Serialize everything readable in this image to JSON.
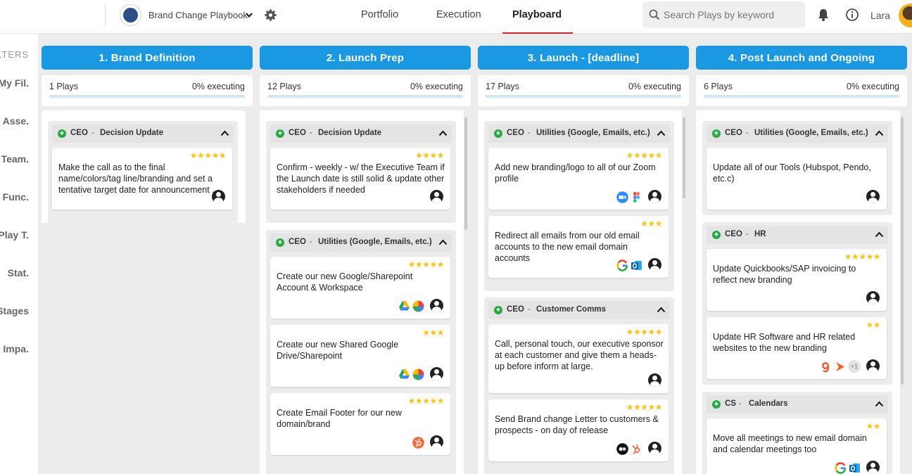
{
  "topbar": {
    "playbook_name": "Brand Change Playbook",
    "nav": [
      "Portfolio",
      "Execution",
      "Playboard"
    ],
    "active_nav": "Playboard",
    "search_placeholder": "Search Plays by keyword",
    "user_name": "Lara",
    "colors": {
      "accent_underline": "#e0202c"
    }
  },
  "filters": {
    "header": "LTERS",
    "items": [
      "My Fil.",
      "Asse.",
      "Team.",
      "Func.",
      "Play T.",
      "Stat.",
      "Stages",
      "Impa."
    ]
  },
  "colors": {
    "column_header": "#1a98e2",
    "stars": "#f5c518",
    "plus_badge": "#29a745"
  },
  "columns": [
    {
      "title": "1. Brand Definition",
      "plays": "1 Plays",
      "executing": "0% executing",
      "progress": 0,
      "groups": [
        {
          "owner": "CEO",
          "category": "Decision Update",
          "cards": [
            {
              "stars": "★★★★★",
              "text": "Make the call as to the final name/colors/tag line/branding and set a tentative target date for announcement ...",
              "tools": []
            }
          ]
        }
      ]
    },
    {
      "title": "2. Launch Prep",
      "plays": "12 Plays",
      "executing": "0% executing",
      "progress": 0,
      "groups": [
        {
          "owner": "CEO",
          "category": "Decision Update",
          "cards": [
            {
              "stars": "★★★★",
              "text": "Confirm - weekly - w/ the Executive Team if the Launch date is still solid & update other stakeholders if needed",
              "tools": []
            }
          ]
        },
        {
          "owner": "CEO",
          "category": "Utilities (Google, Emails, etc.)",
          "cards": [
            {
              "stars": "★★★★★",
              "text": "Create our new Google/Sharepoint Account & Workspace",
              "tools": [
                "google-drive-icon",
                "google-workspace-icon"
              ]
            },
            {
              "stars": "★★★",
              "text": "Create our new Shared Google Drive/Sharepoint",
              "tools": [
                "google-drive-icon",
                "google-workspace-icon"
              ]
            },
            {
              "stars": "★★★★★",
              "text": "Create Email Footer for our new domain/brand",
              "tools": [
                "hubspot-icon"
              ]
            }
          ]
        }
      ]
    },
    {
      "title": "3. Launch - [deadline]",
      "plays": "17 Plays",
      "executing": "0% executing",
      "progress": 0,
      "groups": [
        {
          "owner": "CEO",
          "category": "Utilities (Google, Emails, etc.)",
          "cards": [
            {
              "stars": "★★★★★",
              "text": "Add new branding/logo to all of our Zoom profile",
              "tools": [
                "zoom-icon",
                "figma-icon"
              ]
            },
            {
              "stars": "★★★",
              "text": "Redirect all emails from our old email accounts to the new email domain accounts",
              "tools": [
                "google-icon",
                "outlook-icon"
              ]
            }
          ]
        },
        {
          "owner": "CEO",
          "category": "Customer Comms",
          "cards": [
            {
              "stars": "★★★★★",
              "text": "Call, personal touch, our executive sponsor at each customer and give them a heads-up before inform at large.",
              "tools": []
            },
            {
              "stars": "★★★★★",
              "text": "Send Brand change Letter to customers & prospects - on day of release",
              "tools": [
                "medium-icon",
                "hubspot-sprocket-icon"
              ]
            }
          ]
        }
      ]
    },
    {
      "title": "4. Post Launch and Ongoing",
      "plays": "6 Plays",
      "executing": "0% executing",
      "progress": 0,
      "groups": [
        {
          "owner": "CEO",
          "category": "Utilities (Google, Emails, etc.)",
          "cards": [
            {
              "stars": "",
              "text": "Update all of our Tools (Hubspot, Pendo, etc.c)",
              "tools": []
            }
          ]
        },
        {
          "owner": "CEO",
          "category": "HR",
          "cards": [
            {
              "stars": "★★★★★",
              "text": "Update Quickbooks/SAP invoicing to reflect new branding",
              "tools": []
            },
            {
              "stars": "★★",
              "text": "Update HR Software and HR related websites to the new branding",
              "tools": [
                "g2-icon",
                "arrow-app-icon"
              ],
              "extra": "+1"
            }
          ]
        },
        {
          "owner": "CS",
          "category": "Calendars",
          "cards": [
            {
              "stars": "★★",
              "text": "Move all meetings to new email domain and calendar meetings too",
              "tools": [
                "google-icon",
                "outlook-icon"
              ]
            }
          ]
        }
      ]
    }
  ]
}
